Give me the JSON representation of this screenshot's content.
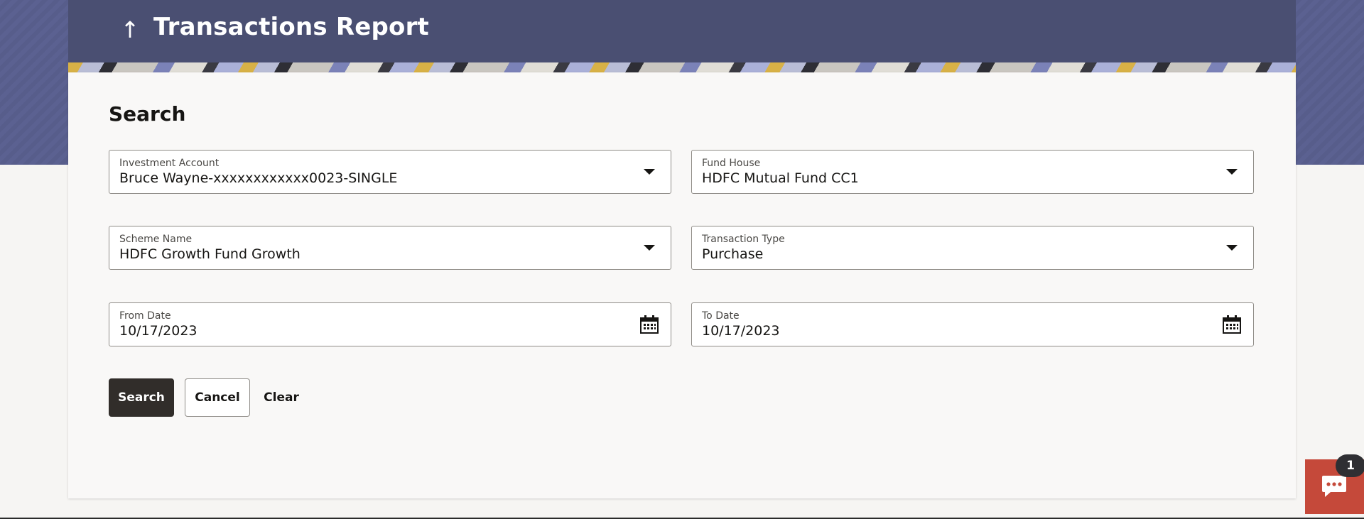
{
  "header": {
    "back_icon_glyph": "↑",
    "title": "Transactions Report"
  },
  "search": {
    "section_title": "Search",
    "fields": {
      "investment_account": {
        "label": "Investment Account",
        "value": "Bruce Wayne-xxxxxxxxxxxx0023-SINGLE",
        "icon": "chevron-down-icon"
      },
      "fund_house": {
        "label": "Fund House",
        "value": "HDFC Mutual Fund CC1",
        "icon": "chevron-down-icon"
      },
      "scheme_name": {
        "label": "Scheme Name",
        "value": "HDFC Growth Fund Growth",
        "icon": "chevron-down-icon"
      },
      "transaction_type": {
        "label": "Transaction Type",
        "value": "Purchase",
        "icon": "chevron-down-icon"
      },
      "from_date": {
        "label": "From Date",
        "value": "10/17/2023",
        "icon": "calendar-icon"
      },
      "to_date": {
        "label": "To Date",
        "value": "10/17/2023",
        "icon": "calendar-icon"
      }
    },
    "buttons": {
      "search_label": "Search",
      "cancel_label": "Cancel",
      "clear_label": "Clear"
    }
  },
  "chat": {
    "badge_count": "1",
    "icon": "chat-bubble-icon"
  },
  "colors": {
    "header_bg": "#4a4f72",
    "band_bg": "#5b6191",
    "primary_button": "#312d2a",
    "chat_widget": "#c5493a"
  }
}
